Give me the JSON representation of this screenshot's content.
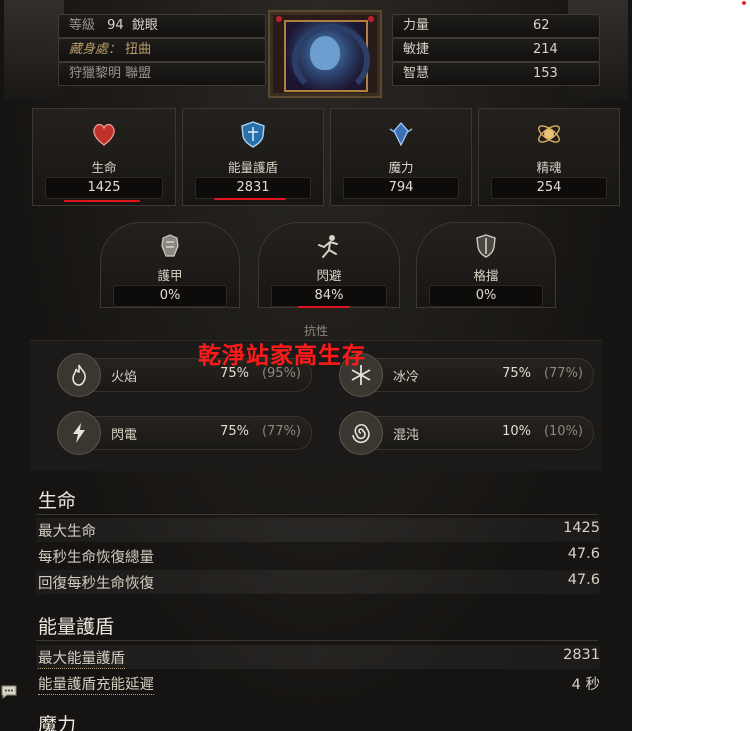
{
  "header": {
    "level_label": "等級",
    "level_value": "94",
    "class_name": "銳眼",
    "stash_label": "藏身處：",
    "stash_value": "扭曲",
    "league": "狩獵黎明 聯盟",
    "attributes": [
      {
        "label": "力量",
        "value": "62"
      },
      {
        "label": "敏捷",
        "value": "214"
      },
      {
        "label": "智慧",
        "value": "153"
      }
    ]
  },
  "main_stats": [
    {
      "label": "生命",
      "value": "1425",
      "icon": "heart-icon",
      "color": "#c0322a"
    },
    {
      "label": "能量護盾",
      "value": "2831",
      "icon": "shield-icon",
      "color": "#3a8bc8"
    },
    {
      "label": "魔力",
      "value": "794",
      "icon": "mana-icon",
      "color": "#4f8fd8"
    },
    {
      "label": "精魂",
      "value": "254",
      "icon": "spirit-icon",
      "color": "#d8b060"
    }
  ],
  "defence_stats": [
    {
      "label": "護甲",
      "value": "0%",
      "icon": "armour-icon"
    },
    {
      "label": "閃避",
      "value": "84%",
      "icon": "evasion-icon"
    },
    {
      "label": "格擋",
      "value": "0%",
      "icon": "block-icon"
    }
  ],
  "resistances": {
    "title": "抗性",
    "items": [
      {
        "label": "火焰",
        "value": "75%",
        "max": "(95%)",
        "icon": "fire-icon"
      },
      {
        "label": "冰冷",
        "value": "75%",
        "max": "(77%)",
        "icon": "cold-icon"
      },
      {
        "label": "閃電",
        "value": "75%",
        "max": "(77%)",
        "icon": "lightning-icon"
      },
      {
        "label": "混沌",
        "value": "10%",
        "max": "(10%)",
        "icon": "chaos-icon"
      }
    ]
  },
  "annotation": "乾淨站家高生存",
  "sections": [
    {
      "title": "生命",
      "rows": [
        {
          "label": "最大生命",
          "value": "1425"
        },
        {
          "label": "每秒生命恢復總量",
          "value": "47.6"
        },
        {
          "label": "回復每秒生命恢復",
          "value": "47.6"
        }
      ]
    },
    {
      "title": "能量護盾",
      "rows": [
        {
          "label": "最大能量護盾",
          "value": "2831"
        },
        {
          "label": "能量護盾充能延遲",
          "value": "4 秒"
        }
      ]
    },
    {
      "title": "魔力",
      "rows": []
    }
  ],
  "colors": {
    "panel_bg": "#141210",
    "annotation_red": "#ff1a1a",
    "underline_red": "#e0141e"
  }
}
